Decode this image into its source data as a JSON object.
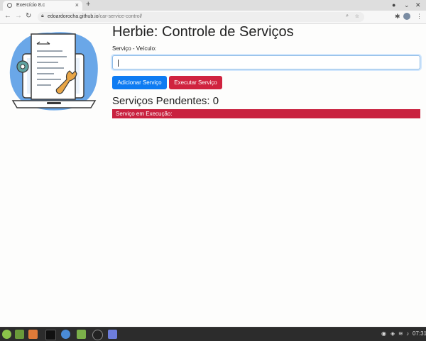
{
  "browser": {
    "tab_title": "Exercício 8.c",
    "tab_close": "×",
    "new_tab": "+",
    "url_host": "edoardorocha.github.io",
    "url_path": "/car-service-control/"
  },
  "page": {
    "title": "Herbie: Controle de Serviços",
    "field_label": "Serviço - Veículo:",
    "input_value": "",
    "add_button": "Adicionar Serviço",
    "execute_button": "Executar Serviço",
    "pending_title": "Serviços Pendentes: 0",
    "executing_label": "Serviço em Execução:"
  },
  "taskbar": {
    "clock": "07:31"
  },
  "colors": {
    "primary": "#0d7bf2",
    "danger": "#d0233f",
    "exec_bar": "#c9213f"
  }
}
